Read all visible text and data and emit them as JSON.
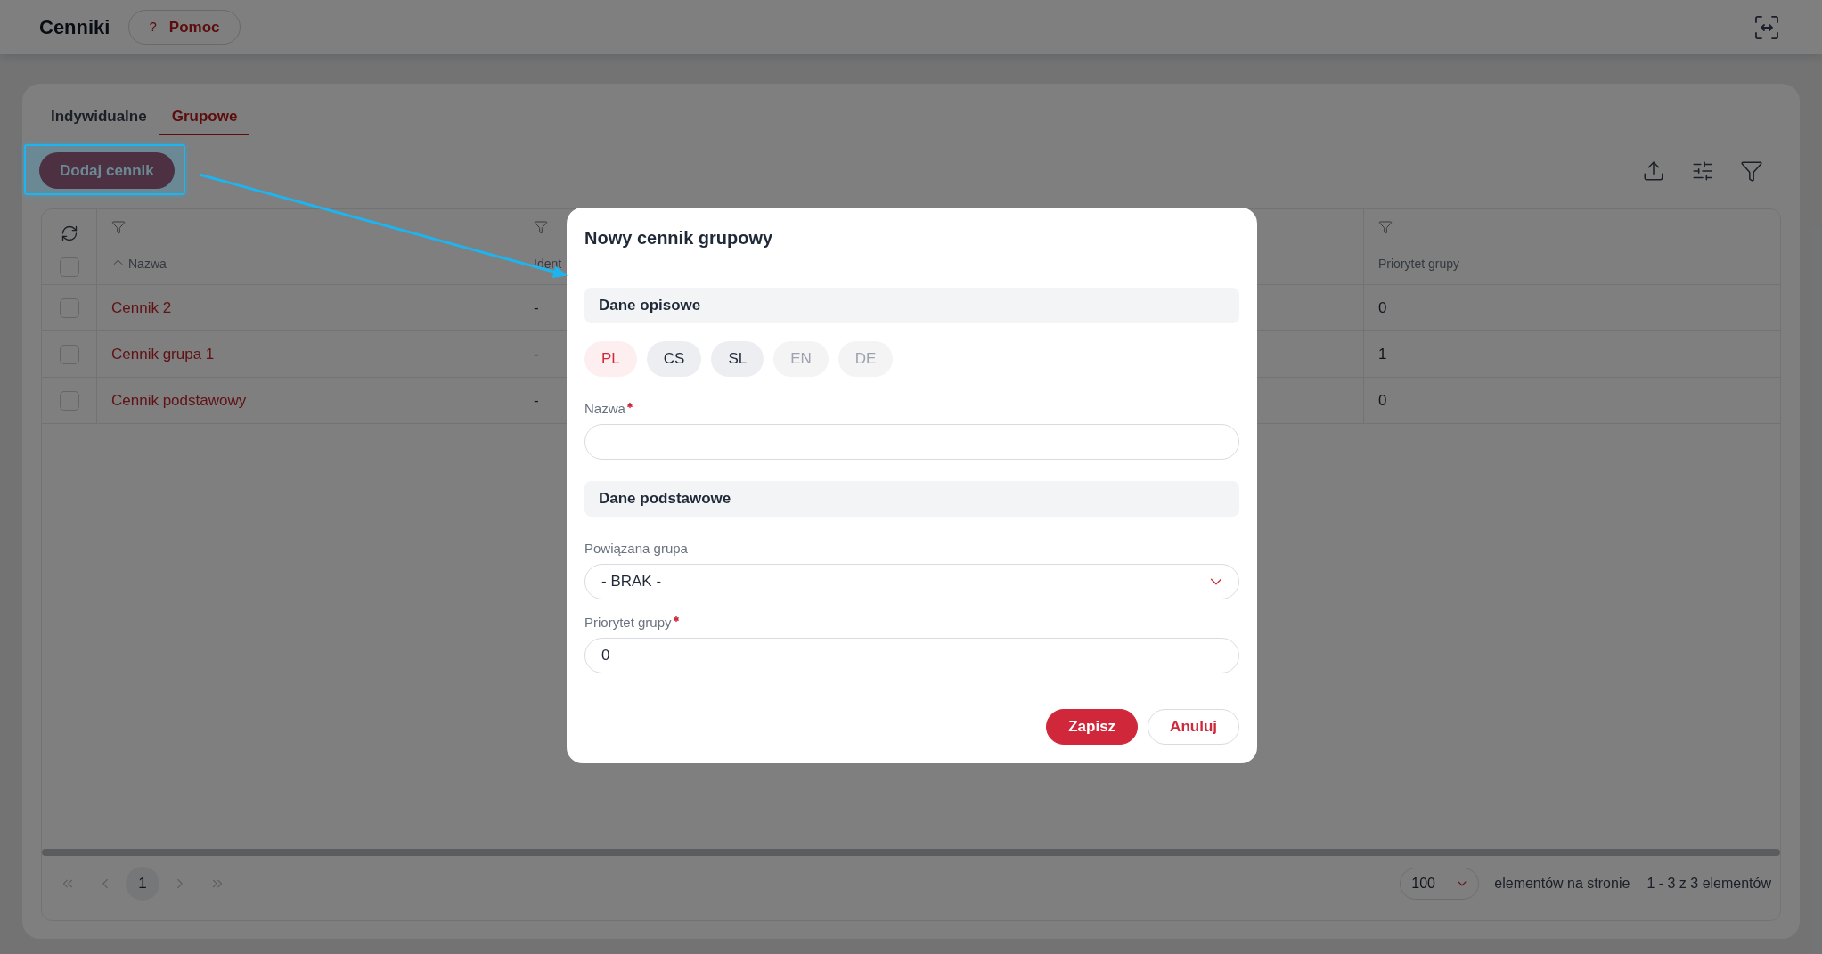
{
  "header": {
    "title": "Cenniki",
    "help_button": {
      "icon": "?",
      "label": "Pomoc"
    }
  },
  "tabs": [
    {
      "label": "Indywidualne",
      "selected": false
    },
    {
      "label": "Grupowe",
      "selected": true
    }
  ],
  "add_button": {
    "label": "Dodaj cennik",
    "highlighted": true
  },
  "table": {
    "select_all_checked": false,
    "columns": [
      {
        "label": "Nazwa",
        "kind": "link",
        "sorted": true
      },
      {
        "label": "Ident",
        "kind": "text",
        "sorted": false
      },
      {
        "label": "Priorytet grupy",
        "kind": "text",
        "sorted": false
      }
    ],
    "rows": [
      {
        "checked": false,
        "cells": [
          "Cennik 2",
          "-",
          "0"
        ]
      },
      {
        "checked": false,
        "cells": [
          "Cennik grupa 1",
          "-",
          "1"
        ]
      },
      {
        "checked": false,
        "cells": [
          "Cennik podstawowy",
          "-",
          "0"
        ]
      }
    ]
  },
  "pagination": {
    "nav": [
      {
        "kind": "first",
        "disabled": true
      },
      {
        "kind": "previous",
        "disabled": true
      },
      {
        "kind": "next",
        "disabled": true
      },
      {
        "kind": "last",
        "disabled": true
      }
    ],
    "pages": [
      {
        "label": "1",
        "selected": true
      }
    ],
    "page_size": "100",
    "page_size_label": "elementów na stronie",
    "range": "1 - 3 z 3 elementów"
  },
  "modal": {
    "title": "Nowy cennik grupowy",
    "sections": [
      {
        "title": "Dane opisowe",
        "languages": [
          {
            "label": "PL",
            "selected": true,
            "disabled": false
          },
          {
            "label": "CS",
            "selected": false,
            "disabled": false
          },
          {
            "label": "SL",
            "selected": false,
            "disabled": false
          },
          {
            "label": "EN",
            "selected": false,
            "disabled": true
          },
          {
            "label": "DE",
            "selected": false,
            "disabled": true
          }
        ],
        "fields": [
          {
            "kind": "input",
            "label": "Nazwa",
            "required": true
          }
        ]
      },
      {
        "title": "Dane podstawowe",
        "fields": [
          {
            "kind": "select",
            "label": "Powiązana grupa",
            "required": false,
            "value": "- BRAK -"
          },
          {
            "kind": "input",
            "label": "Priorytet grupy",
            "required": true,
            "value": "0"
          }
        ]
      }
    ],
    "buttons": [
      {
        "kind": "primary",
        "label": "Zapisz"
      },
      {
        "kind": "secondary",
        "label": "Anuluj"
      }
    ]
  }
}
